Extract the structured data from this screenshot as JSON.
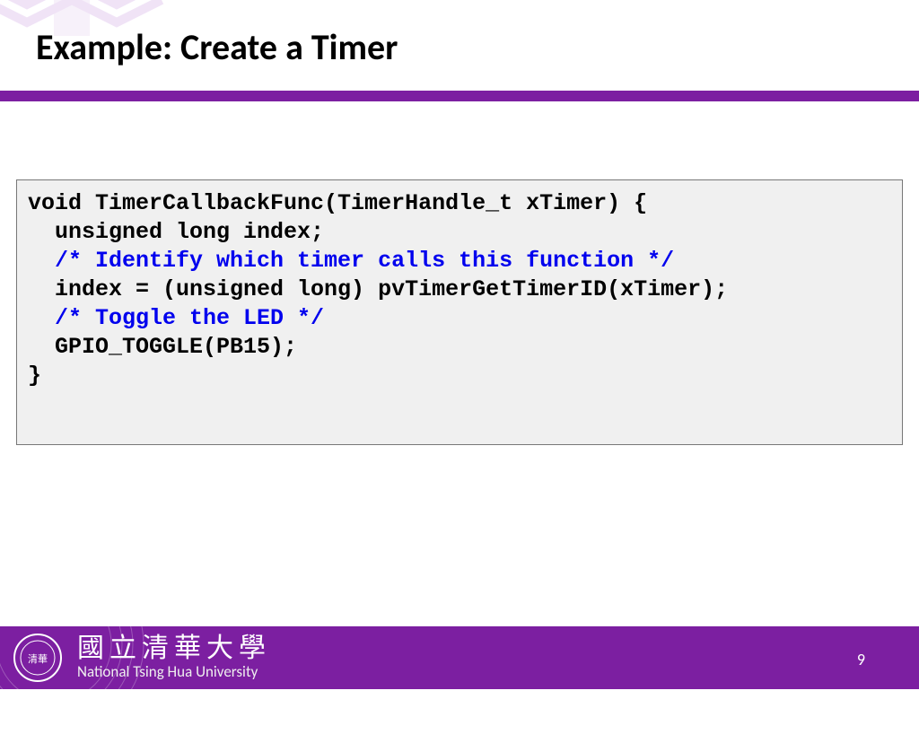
{
  "title": "Example: Create a Timer",
  "code": {
    "l1": "void TimerCallbackFunc(TimerHandle_t xTimer) {",
    "l2": "  unsigned long index;",
    "l3": "  /* Identify which timer calls this function */",
    "l4": "  index = (unsigned long) pvTimerGetTimerID(xTimer);",
    "l5": "  /* Toggle the LED */",
    "l6": "  GPIO_TOGGLE(PB15);",
    "l7": "}"
  },
  "footer": {
    "university_cn": "國立清華大學",
    "university_en": "National Tsing Hua University"
  },
  "page": "9",
  "colors": {
    "accent": "#7c1fa1"
  }
}
